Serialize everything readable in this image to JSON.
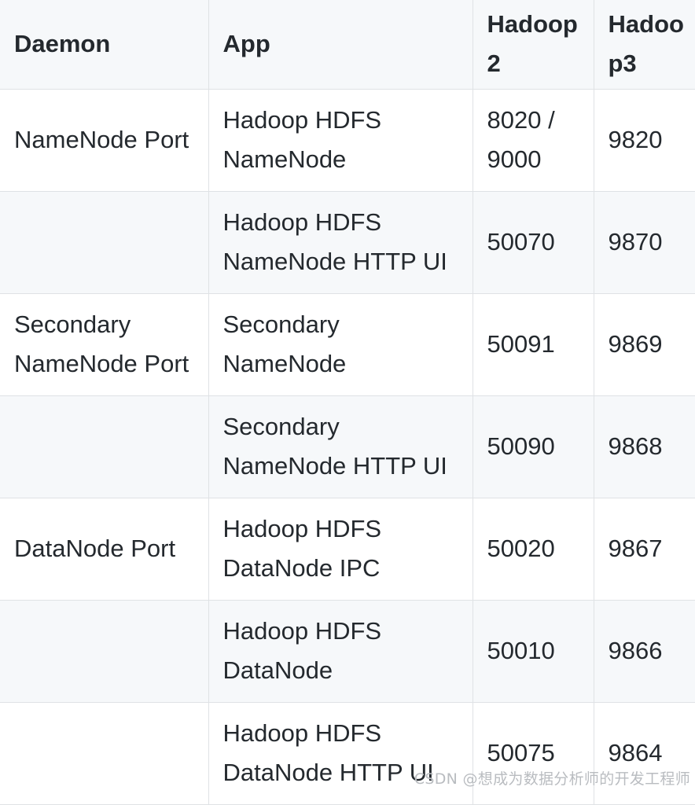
{
  "table": {
    "columns": [
      {
        "key": "daemon",
        "label": "Daemon"
      },
      {
        "key": "app",
        "label": "App"
      },
      {
        "key": "hadoop2",
        "label": "Hadoop2"
      },
      {
        "key": "hadoop3",
        "label": "Hadoop3"
      }
    ],
    "rows": [
      {
        "daemon": "NameNode Port",
        "app": "Hadoop HDFS NameNode",
        "hadoop2": "8020 / 9000",
        "hadoop3": "9820"
      },
      {
        "daemon": "",
        "app": "Hadoop HDFS NameNode HTTP UI",
        "hadoop2": "50070",
        "hadoop3": "9870"
      },
      {
        "daemon": "Secondary NameNode Port",
        "app": "Secondary NameNode",
        "hadoop2": "50091",
        "hadoop3": "9869"
      },
      {
        "daemon": "",
        "app": "Secondary NameNode HTTP UI",
        "hadoop2": "50090",
        "hadoop3": "9868"
      },
      {
        "daemon": "DataNode Port",
        "app": "Hadoop HDFS DataNode IPC",
        "hadoop2": "50020",
        "hadoop3": "9867"
      },
      {
        "daemon": "",
        "app": "Hadoop HDFS DataNode",
        "hadoop2": "50010",
        "hadoop3": "9866"
      },
      {
        "daemon": "",
        "app": "Hadoop HDFS DataNode HTTP UI",
        "hadoop2": "50075",
        "hadoop3": "9864"
      }
    ]
  },
  "watermark": {
    "text": "CSDN @想成为数据分析师的开发工程师"
  },
  "colors": {
    "header_background": "#f6f8fa",
    "stripe_background": "#f6f8fa",
    "row_background": "#ffffff",
    "border": "#dfe2e5",
    "text": "#24292e",
    "watermark_text": "#b9bcc0"
  }
}
